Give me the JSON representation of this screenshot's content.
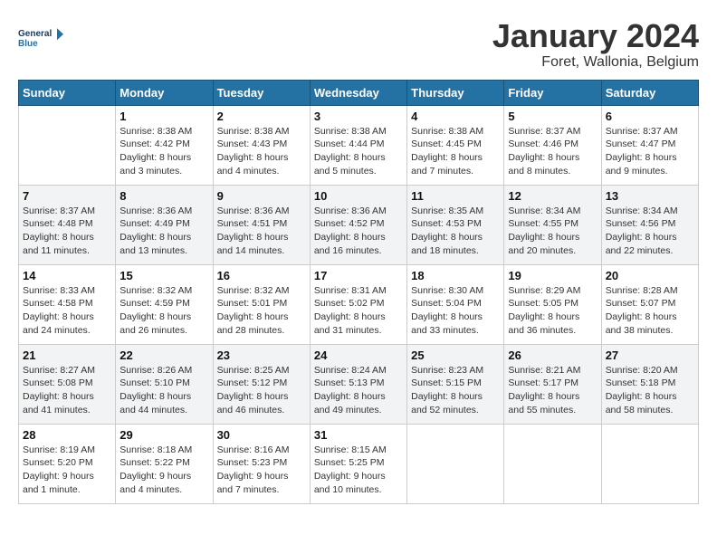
{
  "header": {
    "logo_line1": "General",
    "logo_line2": "Blue",
    "month": "January 2024",
    "location": "Foret, Wallonia, Belgium"
  },
  "days_of_week": [
    "Sunday",
    "Monday",
    "Tuesday",
    "Wednesday",
    "Thursday",
    "Friday",
    "Saturday"
  ],
  "weeks": [
    [
      {
        "num": "",
        "info": ""
      },
      {
        "num": "1",
        "info": "Sunrise: 8:38 AM\nSunset: 4:42 PM\nDaylight: 8 hours\nand 3 minutes."
      },
      {
        "num": "2",
        "info": "Sunrise: 8:38 AM\nSunset: 4:43 PM\nDaylight: 8 hours\nand 4 minutes."
      },
      {
        "num": "3",
        "info": "Sunrise: 8:38 AM\nSunset: 4:44 PM\nDaylight: 8 hours\nand 5 minutes."
      },
      {
        "num": "4",
        "info": "Sunrise: 8:38 AM\nSunset: 4:45 PM\nDaylight: 8 hours\nand 7 minutes."
      },
      {
        "num": "5",
        "info": "Sunrise: 8:37 AM\nSunset: 4:46 PM\nDaylight: 8 hours\nand 8 minutes."
      },
      {
        "num": "6",
        "info": "Sunrise: 8:37 AM\nSunset: 4:47 PM\nDaylight: 8 hours\nand 9 minutes."
      }
    ],
    [
      {
        "num": "7",
        "info": "Sunrise: 8:37 AM\nSunset: 4:48 PM\nDaylight: 8 hours\nand 11 minutes."
      },
      {
        "num": "8",
        "info": "Sunrise: 8:36 AM\nSunset: 4:49 PM\nDaylight: 8 hours\nand 13 minutes."
      },
      {
        "num": "9",
        "info": "Sunrise: 8:36 AM\nSunset: 4:51 PM\nDaylight: 8 hours\nand 14 minutes."
      },
      {
        "num": "10",
        "info": "Sunrise: 8:36 AM\nSunset: 4:52 PM\nDaylight: 8 hours\nand 16 minutes."
      },
      {
        "num": "11",
        "info": "Sunrise: 8:35 AM\nSunset: 4:53 PM\nDaylight: 8 hours\nand 18 minutes."
      },
      {
        "num": "12",
        "info": "Sunrise: 8:34 AM\nSunset: 4:55 PM\nDaylight: 8 hours\nand 20 minutes."
      },
      {
        "num": "13",
        "info": "Sunrise: 8:34 AM\nSunset: 4:56 PM\nDaylight: 8 hours\nand 22 minutes."
      }
    ],
    [
      {
        "num": "14",
        "info": "Sunrise: 8:33 AM\nSunset: 4:58 PM\nDaylight: 8 hours\nand 24 minutes."
      },
      {
        "num": "15",
        "info": "Sunrise: 8:32 AM\nSunset: 4:59 PM\nDaylight: 8 hours\nand 26 minutes."
      },
      {
        "num": "16",
        "info": "Sunrise: 8:32 AM\nSunset: 5:01 PM\nDaylight: 8 hours\nand 28 minutes."
      },
      {
        "num": "17",
        "info": "Sunrise: 8:31 AM\nSunset: 5:02 PM\nDaylight: 8 hours\nand 31 minutes."
      },
      {
        "num": "18",
        "info": "Sunrise: 8:30 AM\nSunset: 5:04 PM\nDaylight: 8 hours\nand 33 minutes."
      },
      {
        "num": "19",
        "info": "Sunrise: 8:29 AM\nSunset: 5:05 PM\nDaylight: 8 hours\nand 36 minutes."
      },
      {
        "num": "20",
        "info": "Sunrise: 8:28 AM\nSunset: 5:07 PM\nDaylight: 8 hours\nand 38 minutes."
      }
    ],
    [
      {
        "num": "21",
        "info": "Sunrise: 8:27 AM\nSunset: 5:08 PM\nDaylight: 8 hours\nand 41 minutes."
      },
      {
        "num": "22",
        "info": "Sunrise: 8:26 AM\nSunset: 5:10 PM\nDaylight: 8 hours\nand 44 minutes."
      },
      {
        "num": "23",
        "info": "Sunrise: 8:25 AM\nSunset: 5:12 PM\nDaylight: 8 hours\nand 46 minutes."
      },
      {
        "num": "24",
        "info": "Sunrise: 8:24 AM\nSunset: 5:13 PM\nDaylight: 8 hours\nand 49 minutes."
      },
      {
        "num": "25",
        "info": "Sunrise: 8:23 AM\nSunset: 5:15 PM\nDaylight: 8 hours\nand 52 minutes."
      },
      {
        "num": "26",
        "info": "Sunrise: 8:21 AM\nSunset: 5:17 PM\nDaylight: 8 hours\nand 55 minutes."
      },
      {
        "num": "27",
        "info": "Sunrise: 8:20 AM\nSunset: 5:18 PM\nDaylight: 8 hours\nand 58 minutes."
      }
    ],
    [
      {
        "num": "28",
        "info": "Sunrise: 8:19 AM\nSunset: 5:20 PM\nDaylight: 9 hours\nand 1 minute."
      },
      {
        "num": "29",
        "info": "Sunrise: 8:18 AM\nSunset: 5:22 PM\nDaylight: 9 hours\nand 4 minutes."
      },
      {
        "num": "30",
        "info": "Sunrise: 8:16 AM\nSunset: 5:23 PM\nDaylight: 9 hours\nand 7 minutes."
      },
      {
        "num": "31",
        "info": "Sunrise: 8:15 AM\nSunset: 5:25 PM\nDaylight: 9 hours\nand 10 minutes."
      },
      {
        "num": "",
        "info": ""
      },
      {
        "num": "",
        "info": ""
      },
      {
        "num": "",
        "info": ""
      }
    ]
  ]
}
